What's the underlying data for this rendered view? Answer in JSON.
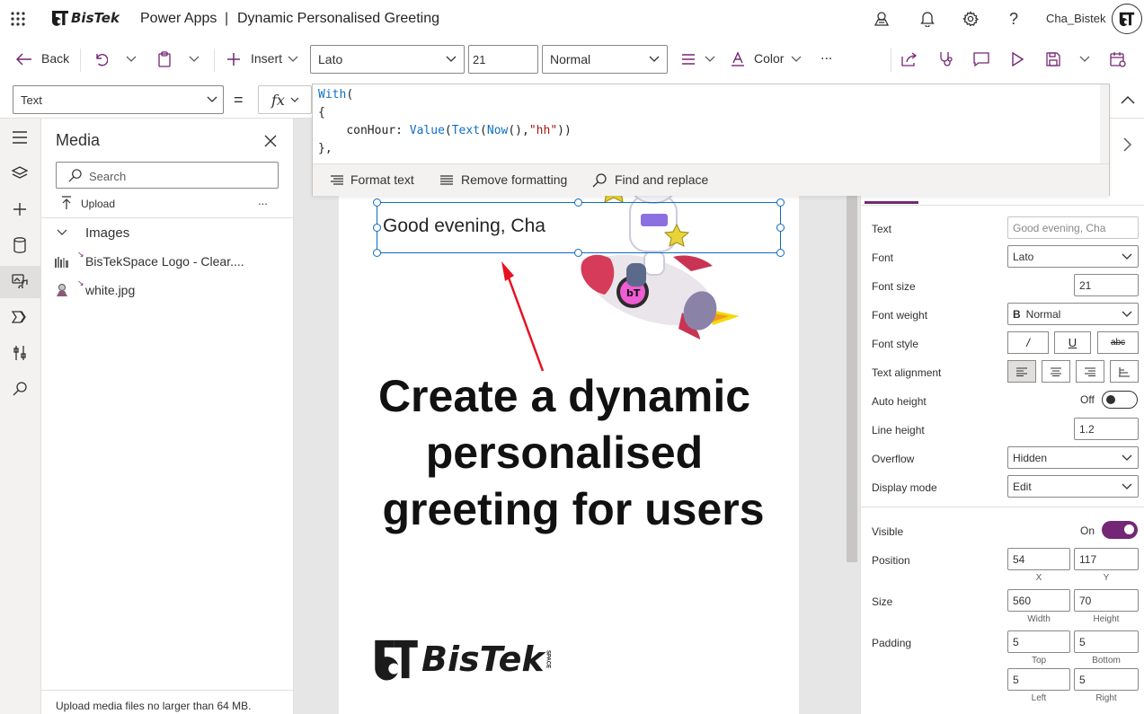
{
  "app": {
    "name": "Power Apps",
    "separator": "|",
    "app_title": "Dynamic Personalised Greeting",
    "user": "Cha_Bistek",
    "logo_text": "BisTek"
  },
  "toolbar": {
    "back": "Back",
    "insert": "Insert",
    "font": "Lato",
    "font_size": "21",
    "weight": "Normal",
    "color": "Color",
    "more": "..."
  },
  "formula": {
    "property": "Text",
    "equals": "=",
    "fx": "fx",
    "lines": [
      {
        "kw": "With",
        "rest": "("
      },
      {
        "kw": "",
        "rest": "{"
      },
      {
        "indent": "    ",
        "name": "conHour: ",
        "f1": "Value",
        "p1": "(",
        "f2": "Text",
        "p2": "(",
        "f3": "Now",
        "p3": "(),",
        "s": "\"hh\"",
        "p4": "))"
      },
      {
        "kw": "",
        "rest": "},"
      }
    ],
    "tools": {
      "format": "Format text",
      "remove": "Remove formatting",
      "find": "Find and replace"
    }
  },
  "media": {
    "title": "Media",
    "search_placeholder": "Search",
    "upload": "Upload",
    "more": "...",
    "section": "Images",
    "items": [
      {
        "name": "BisTekSpace Logo - Clear...."
      },
      {
        "name": "white.jpg"
      }
    ],
    "footer": "Upload media files no larger than 64 MB."
  },
  "canvas": {
    "greeting": "Good evening, Cha",
    "headline": [
      "Create a dynamic",
      "personalised",
      "greeting for users"
    ],
    "logo_text": "BisTek",
    "logo_small": "SPACE"
  },
  "props": {
    "rows": [
      {
        "label": "Text",
        "value": "Good evening, Cha"
      },
      {
        "label": "Font",
        "value": "Lato"
      },
      {
        "label": "Font size",
        "value": "21"
      },
      {
        "label": "Font weight",
        "value": "Normal"
      },
      {
        "label": "Font style",
        "value": ""
      },
      {
        "label": "Text alignment",
        "value": ""
      },
      {
        "label": "Auto height",
        "value": "Off"
      },
      {
        "label": "Line height",
        "value": "1.2"
      },
      {
        "label": "Overflow",
        "value": "Hidden"
      },
      {
        "label": "Display mode",
        "value": "Edit"
      }
    ],
    "visible": {
      "label": "Visible",
      "value": "On"
    },
    "position": {
      "label": "Position",
      "x": "54",
      "y": "117",
      "x_label": "X",
      "y_label": "Y"
    },
    "size": {
      "label": "Size",
      "w": "560",
      "h": "70",
      "w_label": "Width",
      "h_label": "Height"
    },
    "padding": {
      "label": "Padding",
      "top": "5",
      "bottom": "5",
      "left": "5",
      "right": "5",
      "top_label": "Top",
      "bottom_label": "Bottom",
      "left_label": "Left",
      "right_label": "Right"
    }
  },
  "colors": {
    "accent": "#742774",
    "selection": "#0f6cbd",
    "arrow": "#e81123"
  }
}
